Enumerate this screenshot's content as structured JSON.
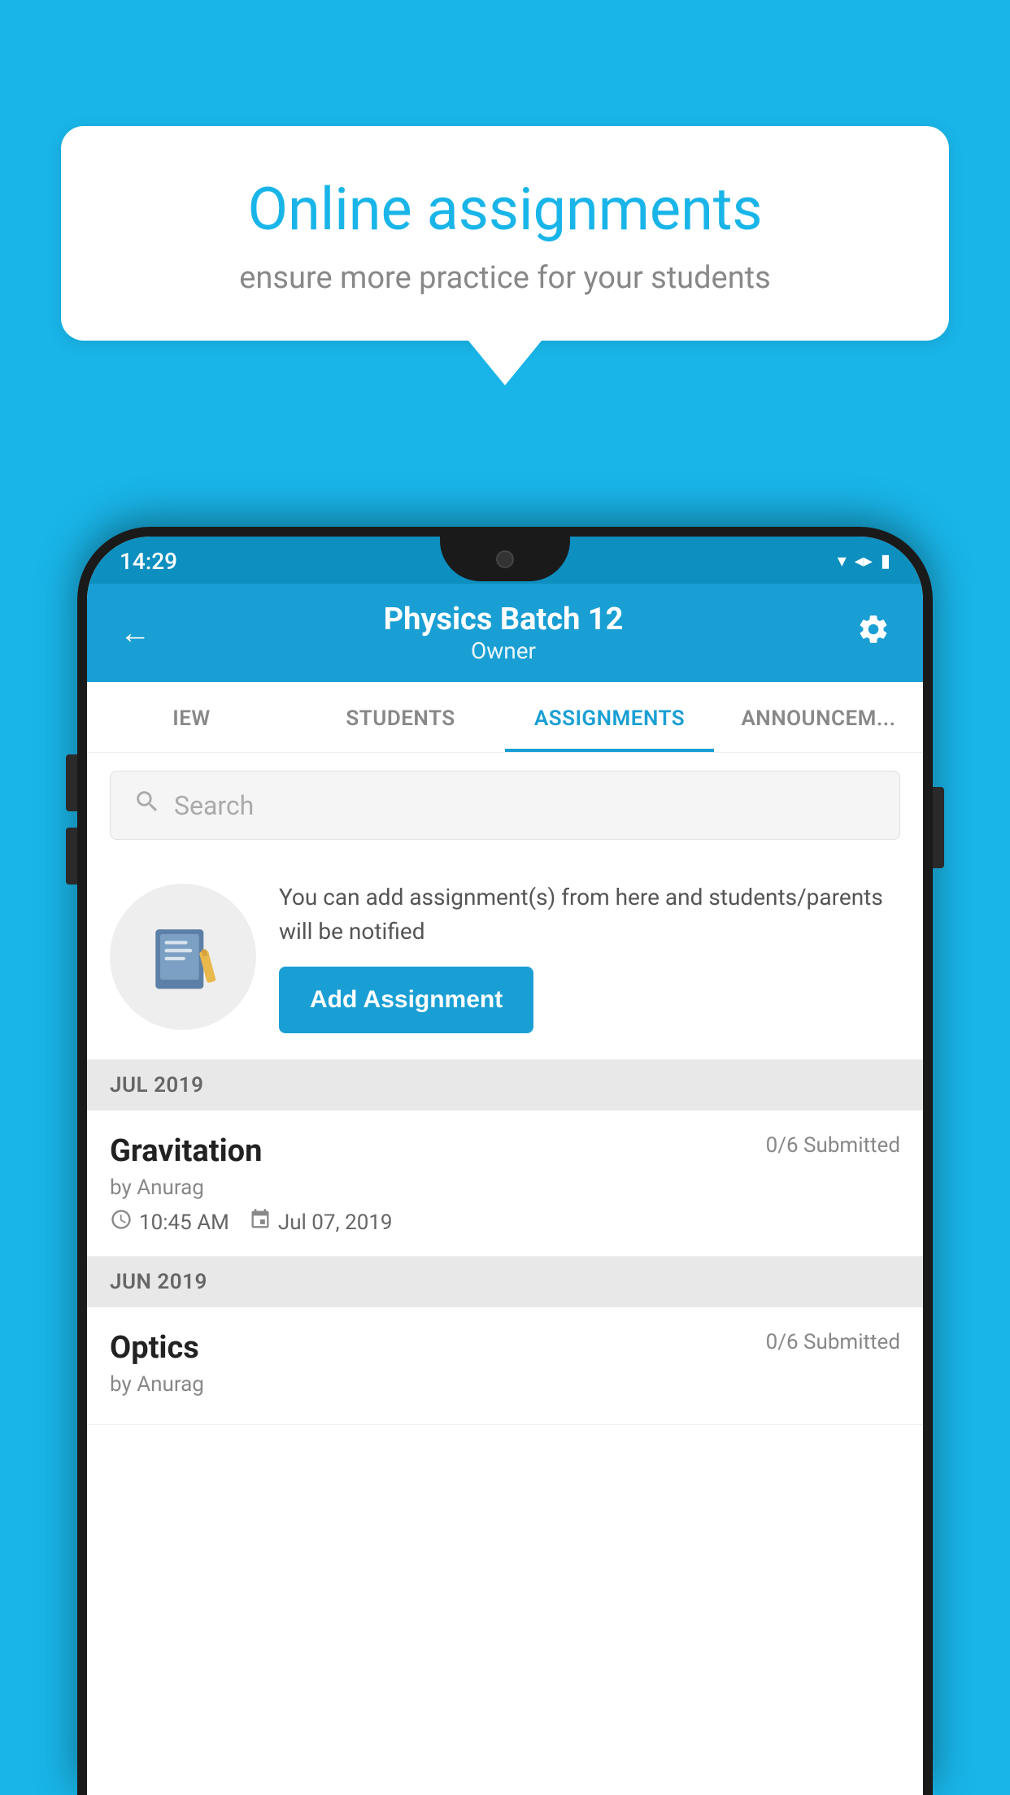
{
  "background_color": "#19b5e8",
  "speech_bubble": {
    "title": "Online assignments",
    "subtitle": "ensure more practice for your students"
  },
  "status_bar": {
    "time": "14:29",
    "icons": [
      "wifi",
      "signal",
      "battery"
    ]
  },
  "app_bar": {
    "title": "Physics Batch 12",
    "subtitle": "Owner",
    "back_label": "←",
    "settings_label": "⚙"
  },
  "tabs": [
    {
      "label": "IEW",
      "active": false
    },
    {
      "label": "STUDENTS",
      "active": false
    },
    {
      "label": "ASSIGNMENTS",
      "active": true
    },
    {
      "label": "ANNOUNCEM...",
      "active": false
    }
  ],
  "search": {
    "placeholder": "Search"
  },
  "promo": {
    "text": "You can add assignment(s) from here and students/parents will be notified",
    "button_label": "Add Assignment"
  },
  "sections": [
    {
      "header": "JUL 2019",
      "assignments": [
        {
          "name": "Gravitation",
          "submitted": "0/6 Submitted",
          "by": "by Anurag",
          "time": "10:45 AM",
          "date": "Jul 07, 2019"
        }
      ]
    },
    {
      "header": "JUN 2019",
      "assignments": [
        {
          "name": "Optics",
          "submitted": "0/6 Submitted",
          "by": "by Anurag",
          "time": "",
          "date": ""
        }
      ]
    }
  ]
}
